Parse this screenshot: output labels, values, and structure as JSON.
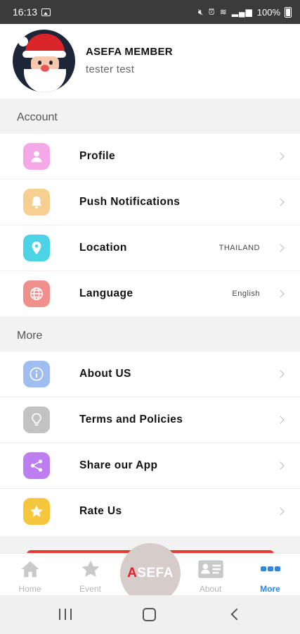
{
  "status_bar": {
    "time": "16:13",
    "battery": "100%"
  },
  "profile": {
    "name": "ASEFA MEMBER",
    "subtitle": "tester test"
  },
  "sections": {
    "account": {
      "title": "Account",
      "items": [
        {
          "label": "Profile",
          "value": "",
          "icon": "person-icon",
          "color": "#f5a8e8"
        },
        {
          "label": "Push Notifications",
          "value": "",
          "icon": "bell-icon",
          "color": "#f7cf91"
        },
        {
          "label": "Location",
          "value": "THAILAND",
          "icon": "location-pin-icon",
          "color": "#4dd3e6"
        },
        {
          "label": "Language",
          "value": "English",
          "icon": "globe-icon",
          "color": "#f0908c"
        }
      ]
    },
    "more": {
      "title": "More",
      "items": [
        {
          "label": "About US",
          "value": "",
          "icon": "info-icon",
          "color": "#9fbdf0"
        },
        {
          "label": "Terms and Policies",
          "value": "",
          "icon": "lightbulb-icon",
          "color": "#c2c2c2"
        },
        {
          "label": "Share our App",
          "value": "",
          "icon": "share-icon",
          "color": "#bd7ef0"
        },
        {
          "label": "Rate Us",
          "value": "",
          "icon": "star-icon",
          "color": "#f6c63c"
        }
      ]
    }
  },
  "bottom_nav": {
    "items": [
      {
        "label": "Home",
        "icon": "home-icon"
      },
      {
        "label": "Event",
        "icon": "star-icon"
      },
      {
        "label": "About",
        "icon": "id-card-icon"
      },
      {
        "label": "More",
        "icon": "more-dots-icon"
      }
    ],
    "center": {
      "first_letter": "A",
      "rest": "SEFA"
    },
    "active_color": "#2e86de",
    "inactive_color": "#b5b5b5"
  },
  "colors": {
    "logout_accent": "#e23b35"
  }
}
